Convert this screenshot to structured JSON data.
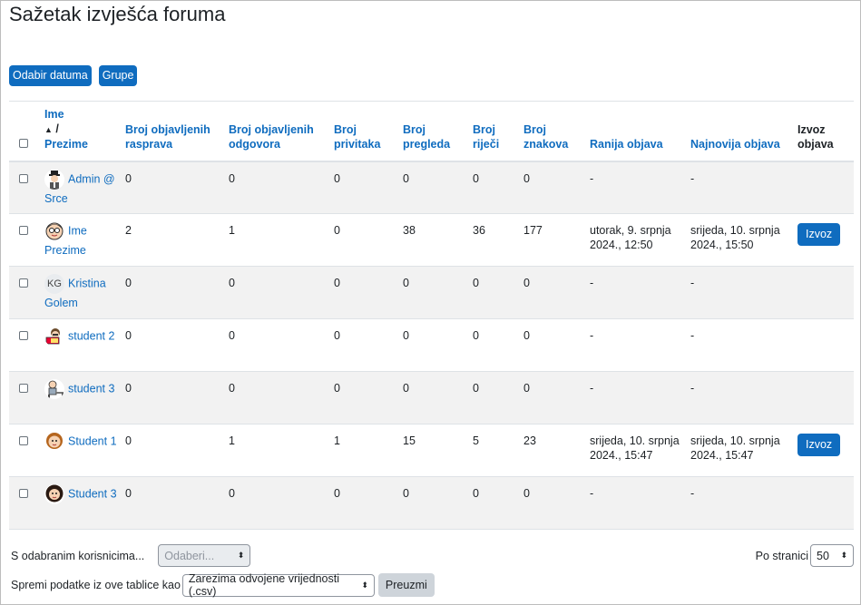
{
  "page": {
    "title": "Sažetak izvješća foruma"
  },
  "toolbar": {
    "date_button": "Odabir datuma",
    "groups_button": "Grupe"
  },
  "table": {
    "headers": {
      "name_first": "Ime",
      "name_sep": "/",
      "name_last": "Prezime",
      "discussions": "Broj objavljenih rasprava",
      "replies": "Broj objavljenih odgovora",
      "attachments": "Broj privitaka",
      "views": "Broj pregleda",
      "words": "Broj riječi",
      "chars": "Broj znakova",
      "earliest": "Ranija objava",
      "latest": "Najnovija objava",
      "export": "Izvoz objava"
    },
    "rows": [
      {
        "name": "Admin @ Srce",
        "avatar": "admin-avatar",
        "discussions": "0",
        "replies": "0",
        "attachments": "0",
        "views": "0",
        "words": "0",
        "chars": "0",
        "earliest": "-",
        "latest": "-",
        "export": ""
      },
      {
        "name": "Ime Prezime",
        "avatar": "glasses-man-avatar",
        "discussions": "2",
        "replies": "1",
        "attachments": "0",
        "views": "38",
        "words": "36",
        "chars": "177",
        "earliest": "utorak, 9. srpnja 2024., 12:50",
        "latest": "srijeda, 10. srpnja 2024., 15:50",
        "export": "Izvoz"
      },
      {
        "name": "Kristina Golem",
        "avatar": "initials-avatar",
        "initials": "KG",
        "discussions": "0",
        "replies": "0",
        "attachments": "0",
        "views": "0",
        "words": "0",
        "chars": "0",
        "earliest": "-",
        "latest": "-",
        "export": ""
      },
      {
        "name": "student 2",
        "avatar": "student-reading-avatar",
        "discussions": "0",
        "replies": "0",
        "attachments": "0",
        "views": "0",
        "words": "0",
        "chars": "0",
        "earliest": "-",
        "latest": "-",
        "export": ""
      },
      {
        "name": "student 3",
        "avatar": "student-desk-avatar",
        "discussions": "0",
        "replies": "0",
        "attachments": "0",
        "views": "0",
        "words": "0",
        "chars": "0",
        "earliest": "-",
        "latest": "-",
        "export": ""
      },
      {
        "name": "Student 1",
        "avatar": "woman-avatar",
        "discussions": "0",
        "replies": "1",
        "attachments": "1",
        "views": "15",
        "words": "5",
        "chars": "23",
        "earliest": "srijeda, 10. srpnja 2024., 15:47",
        "latest": "srijeda, 10. srpnja 2024., 15:47",
        "export": "Izvoz"
      },
      {
        "name": "Student 3",
        "avatar": "dark-hair-woman-avatar",
        "discussions": "0",
        "replies": "0",
        "attachments": "0",
        "views": "0",
        "words": "0",
        "chars": "0",
        "earliest": "-",
        "latest": "-",
        "export": ""
      }
    ]
  },
  "footer": {
    "with_selected_label": "S odabranim korisnicima...",
    "choose_placeholder": "Odaberi...",
    "per_page_label": "Po stranici",
    "per_page_value": "50",
    "save_label": "Spremi podatke iz ove tablice kao",
    "format_value": "Zarezima odvojene vrijednosti (.csv)",
    "download_button": "Preuzmi"
  },
  "colors": {
    "accent": "#0f6cbf",
    "stripe": "#f2f2f2",
    "secondary_button": "#ced4da"
  }
}
